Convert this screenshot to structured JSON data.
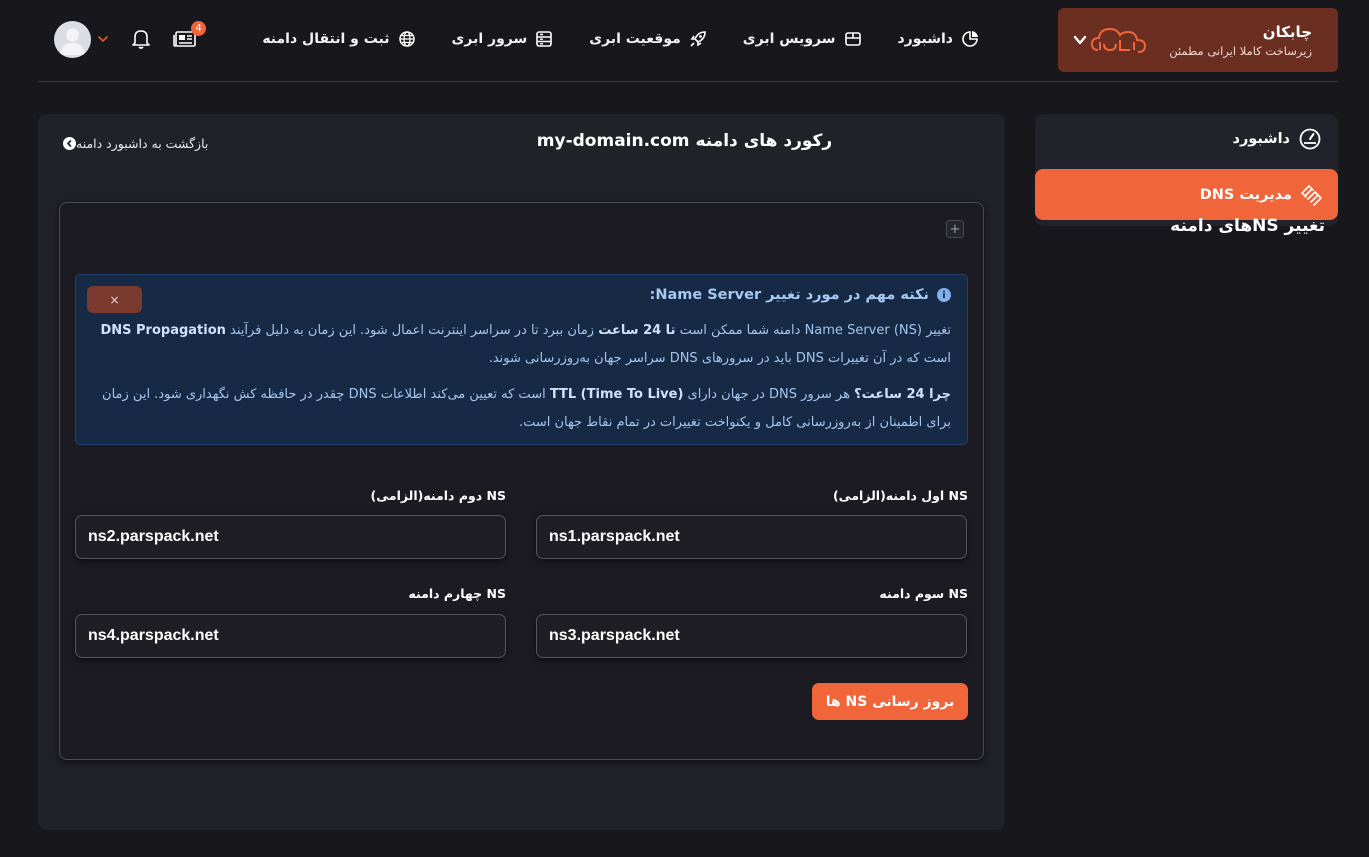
{
  "brand": {
    "title": "چابکان",
    "subtitle": "زیرساخت کاملا ایرانی مطمئن",
    "logo_icon": "chabokan-cloud-logo",
    "accent": "#f0653a",
    "background": "#6b2f22"
  },
  "nav": {
    "items": [
      {
        "label": "داشبورد",
        "icon": "pie-chart-icon"
      },
      {
        "label": "سرویس ابری",
        "icon": "package-icon"
      },
      {
        "label": "موقعیت ابری",
        "icon": "rocket-icon"
      },
      {
        "label": "سرور ابری",
        "icon": "server-icon"
      },
      {
        "label": "ثبت و انتقال دامنه",
        "icon": "globe-icon"
      }
    ]
  },
  "header": {
    "notification_count": "4"
  },
  "sidebar": {
    "items": [
      {
        "label": "داشبورد",
        "icon": "speedometer-icon",
        "active": false
      },
      {
        "label": "مدیریت DNS",
        "icon": "dns-icon",
        "active": true
      }
    ]
  },
  "page": {
    "title": "رکورد های دامنه my-domain.com",
    "back_label": "بازگشت به داشبورد دامنه"
  },
  "card": {
    "title": "تغییر NSهای دامنه"
  },
  "alert": {
    "heading": "نکته مهم در مورد تغییر Name Server:",
    "p1_a": "تغییر Name Server (NS) دامنه شما ممکن است ",
    "p1_b": "تا 24 ساعت",
    "p1_c": " زمان ببرد تا در سراسر اینترنت اعمال شود. این زمان به دلیل فرآیند ",
    "p1_d": "DNS Propagation",
    "p1_e": " است که در آن تغییرات DNS باید در سرورهای DNS سراسر جهان به‌روزرسانی شوند.",
    "p2_a": "چرا 24 ساعت؟",
    "p2_b": " هر سرور DNS در جهان دارای ",
    "p2_c": "TTL (Time To Live)",
    "p2_d": " است که تعیین می‌کند اطلاعات DNS چقدر در حافظه کش نگهداری شود. این زمان برای اطمینان از به‌روزرسانی کامل و یکنواخت تغییرات در تمام نقاط جهان است.",
    "close_label": "×"
  },
  "form": {
    "ns1": {
      "label": "NS اول دامنه(الزامی)",
      "value": "ns1.parspack.net"
    },
    "ns2": {
      "label": "NS دوم دامنه(الزامی)",
      "value": "ns2.parspack.net"
    },
    "ns3": {
      "label": "NS سوم دامنه",
      "value": "ns3.parspack.net"
    },
    "ns4": {
      "label": "NS چهارم دامنه",
      "value": "ns4.parspack.net"
    },
    "submit_label": "بروز رسانی NS ها"
  }
}
